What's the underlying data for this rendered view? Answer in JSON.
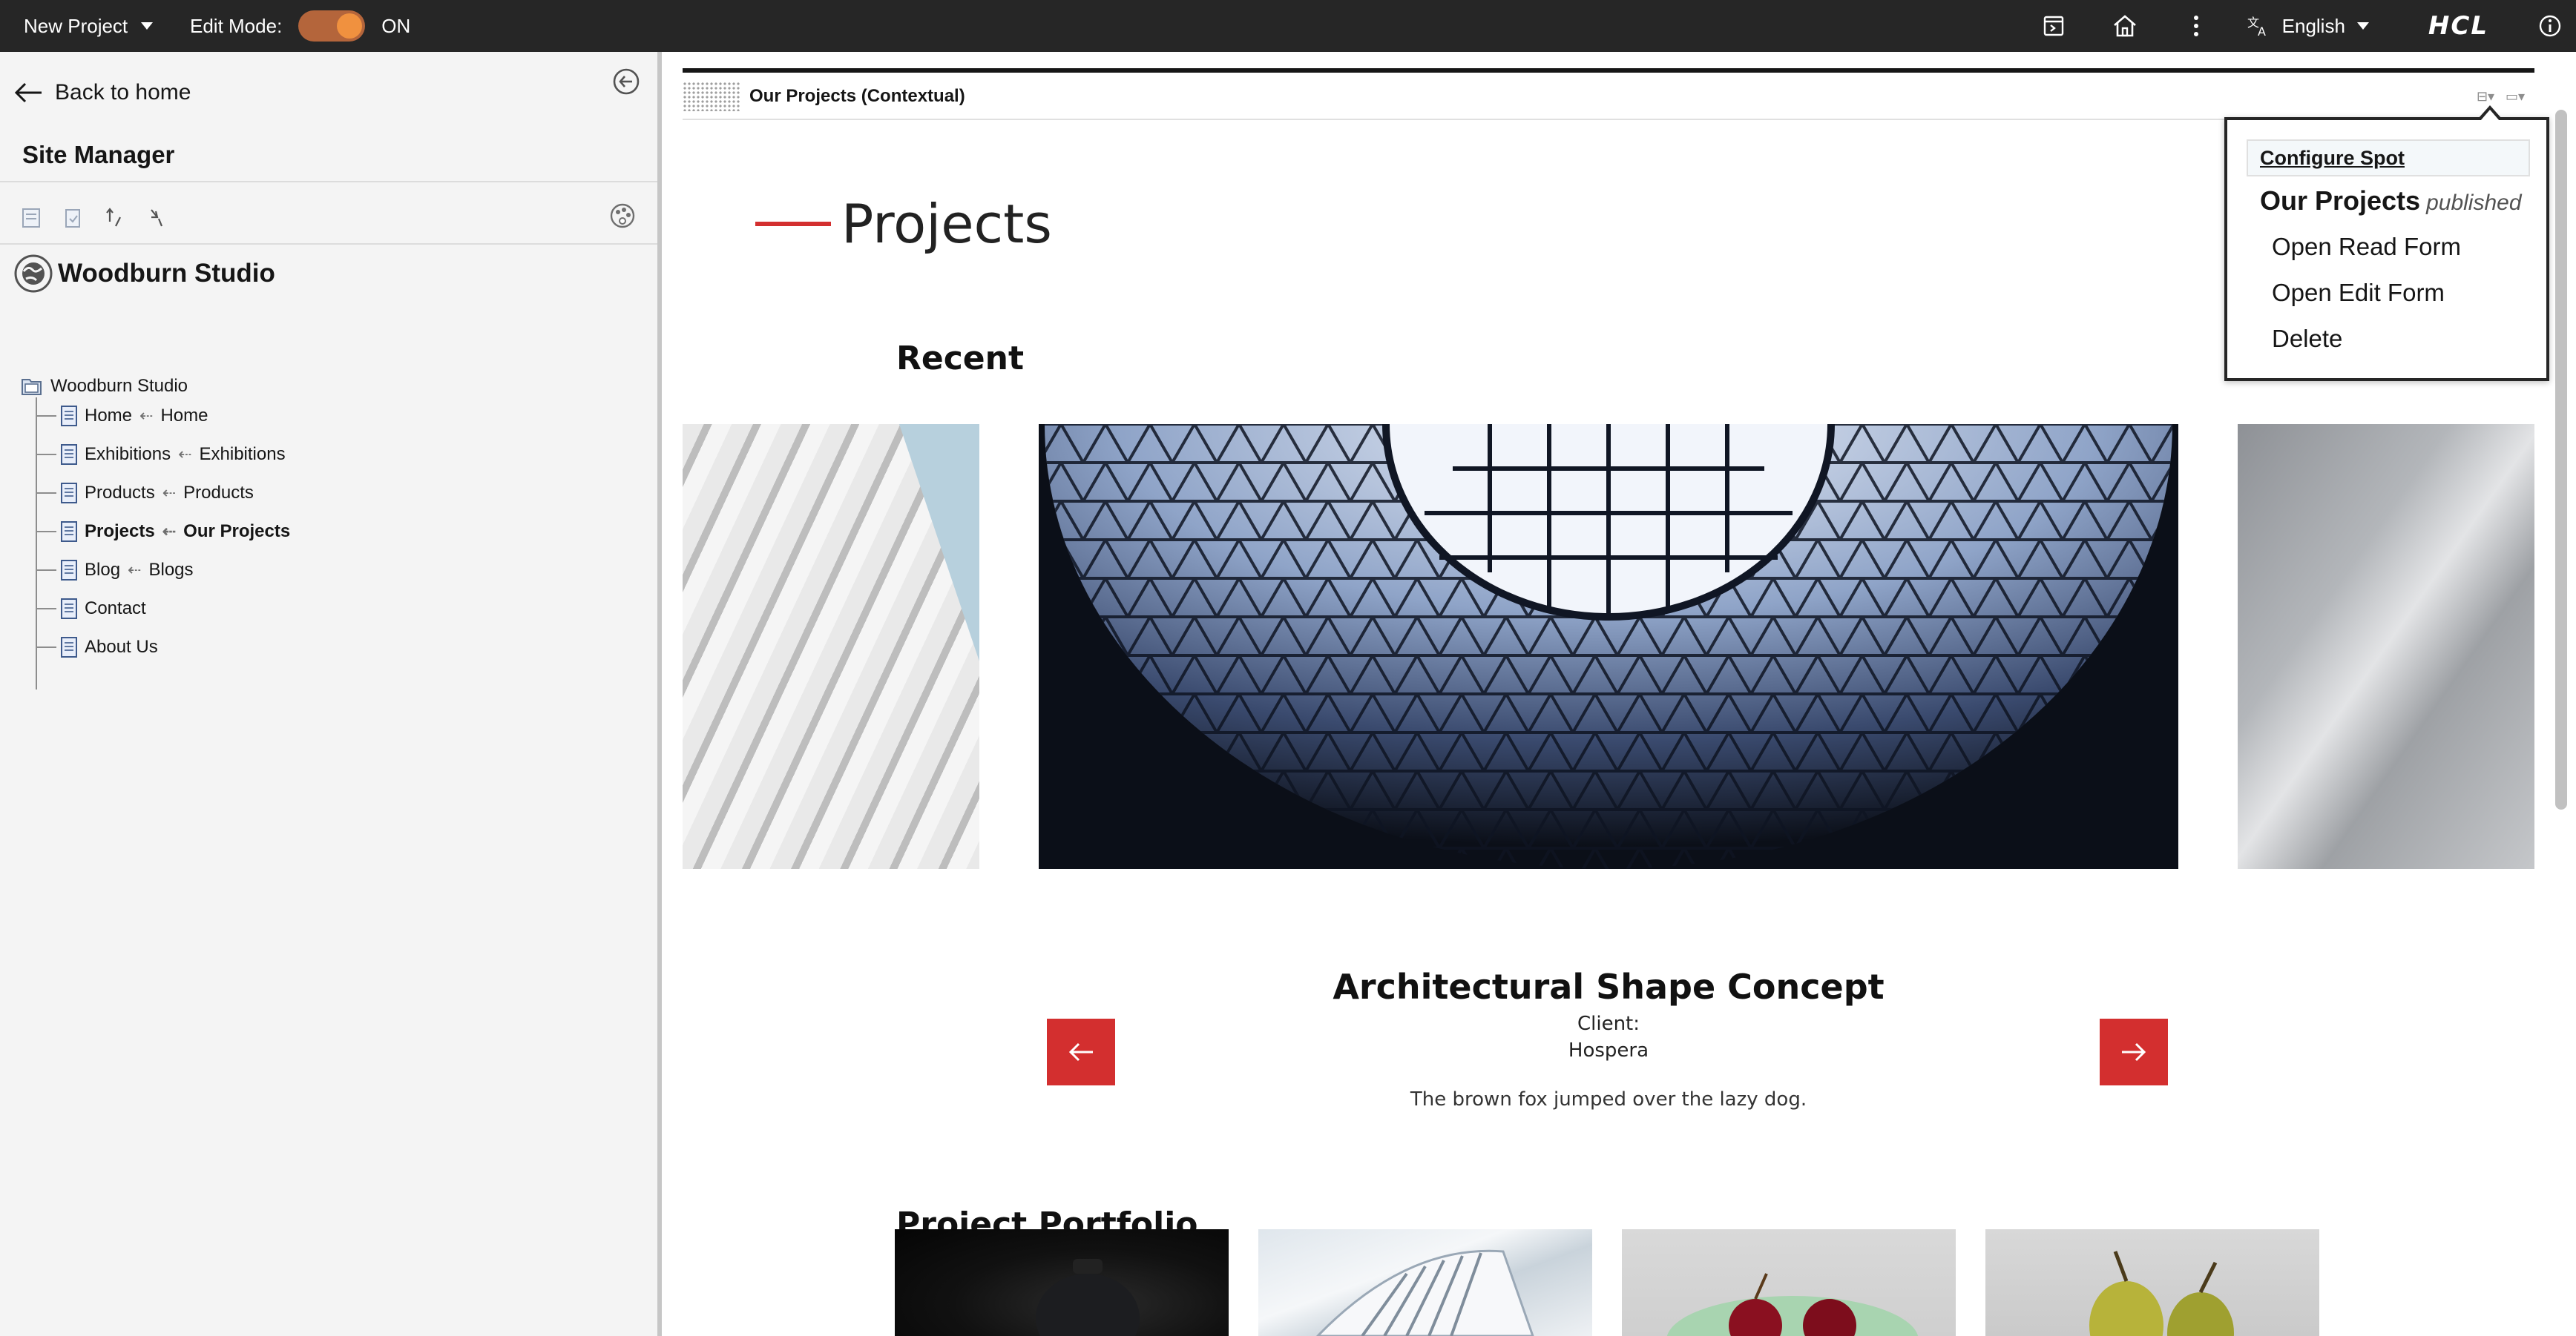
{
  "topbar": {
    "project_label": "New Project",
    "edit_mode_label": "Edit Mode:",
    "edit_mode_state": "ON",
    "language": "English",
    "brand": "HCL",
    "accent_toggle": "#f0913f"
  },
  "sidebar": {
    "back_label": "Back to home",
    "title": "Site Manager",
    "site_name": "Woodburn Studio",
    "tree_root": "Woodburn Studio",
    "tree_items": [
      {
        "label": "Home",
        "target": "Home"
      },
      {
        "label": "Exhibitions",
        "target": "Exhibitions"
      },
      {
        "label": "Products",
        "target": "Products"
      },
      {
        "label": "Projects",
        "target": "Our Projects",
        "selected": true
      },
      {
        "label": "Blog",
        "target": "Blogs"
      },
      {
        "label": "Contact"
      },
      {
        "label": "About Us"
      }
    ]
  },
  "spot": {
    "title": "Our Projects (Contextual)"
  },
  "page": {
    "heading": "Projects",
    "recent_heading": "Recent",
    "project_name": "Architectural Shape Concept",
    "client_label": "Client:",
    "client_name": "Hospera",
    "description": "The brown fox jumped over the lazy dog.",
    "portfolio_heading": "Project Portfolio",
    "accent_color": "#d32f2f"
  },
  "context_menu": {
    "configure": "Configure Spot",
    "item_title": "Our Projects",
    "item_status": "published",
    "actions": [
      "Open Read Form",
      "Open Edit Form",
      "Delete"
    ]
  }
}
